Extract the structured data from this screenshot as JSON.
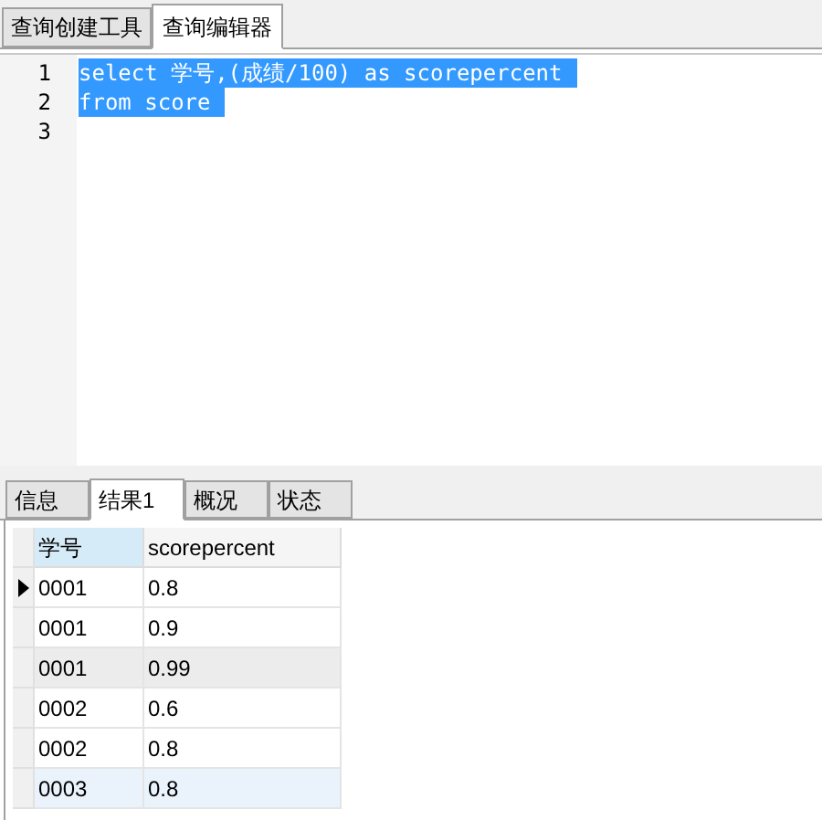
{
  "editor_tabs": [
    {
      "label": "查询创建工具",
      "selected": false
    },
    {
      "label": "查询编辑器",
      "selected": true
    }
  ],
  "editor": {
    "lines": [
      {
        "number": "1",
        "code": "select 学号,(成绩/100) as scorepercent",
        "selected": true
      },
      {
        "number": "2",
        "code": "from score",
        "selected": true
      },
      {
        "number": "3"
      }
    ]
  },
  "result_tabs": [
    {
      "label": "信息",
      "selected": false
    },
    {
      "label": "结果1",
      "selected": true
    },
    {
      "label": "概况",
      "selected": false
    },
    {
      "label": "状态",
      "selected": false
    }
  ],
  "table": {
    "columns": [
      "学号",
      "scorepercent"
    ],
    "rows": [
      {
        "cells": [
          "0001",
          "0.8"
        ],
        "current": true,
        "hovered": false,
        "selected": false
      },
      {
        "cells": [
          "0001",
          "0.9"
        ],
        "current": false,
        "hovered": false,
        "selected": false
      },
      {
        "cells": [
          "0001",
          "0.99"
        ],
        "current": false,
        "hovered": true,
        "selected": false
      },
      {
        "cells": [
          "0002",
          "0.6"
        ],
        "current": false,
        "hovered": false,
        "selected": false
      },
      {
        "cells": [
          "0002",
          "0.8"
        ],
        "current": false,
        "hovered": false,
        "selected": false
      },
      {
        "cells": [
          "0003",
          "0.8"
        ],
        "current": false,
        "hovered": false,
        "selected": true
      }
    ]
  }
}
